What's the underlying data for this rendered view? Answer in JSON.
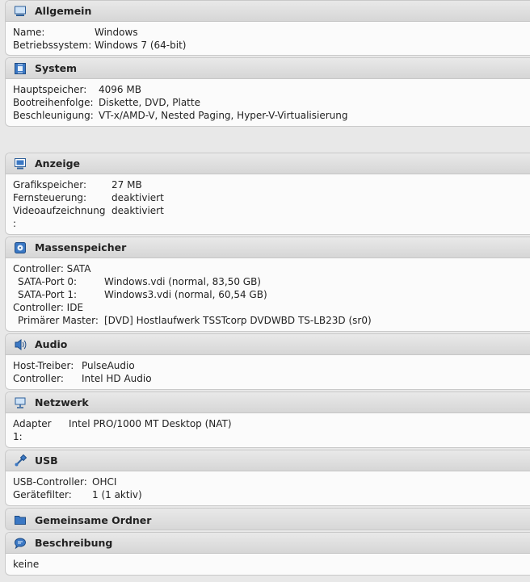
{
  "general": {
    "title": "Allgemein",
    "icon": "monitor-icon",
    "rows": [
      {
        "key": "Name:",
        "value": "Windows"
      },
      {
        "key": "Betriebssystem:",
        "value": "Windows 7 (64-bit)"
      }
    ]
  },
  "system": {
    "title": "System",
    "icon": "chip-icon",
    "rows": [
      {
        "key": "Hauptspeicher:",
        "value": "4096 MB"
      },
      {
        "key": "Bootreihenfolge:",
        "value": "Diskette, DVD, Platte"
      },
      {
        "key": "Beschleunigung:",
        "value": "VT-x/AMD-V, Nested Paging, Hyper-V-Virtualisierung"
      }
    ]
  },
  "display": {
    "title": "Anzeige",
    "icon": "display-icon",
    "rows": [
      {
        "key": "Grafikspeicher:",
        "value": "27 MB"
      },
      {
        "key": "Fernsteuerung:",
        "value": "deaktiviert"
      },
      {
        "key": "Videoaufzeichnung",
        "value": "deaktiviert"
      },
      {
        "key": ":",
        "value": ""
      }
    ]
  },
  "storage": {
    "title": "Massenspeicher",
    "icon": "storage-icon",
    "controller_sata": "Controller: SATA",
    "sata0_key": "SATA-Port 0:",
    "sata0_value": "Windows.vdi (normal, 83,50 GB)",
    "sata1_key": "SATA-Port 1:",
    "sata1_value": "Windows3.vdi (normal, 60,54 GB)",
    "controller_ide": "Controller: IDE",
    "ide_key": "Primärer Master:",
    "ide_value": "[DVD] Hostlaufwerk TSSTcorp DVDWBD TS-LB23D  (sr0)"
  },
  "audio": {
    "title": "Audio",
    "icon": "speaker-icon",
    "rows": [
      {
        "key": "Host-Treiber:",
        "value": "PulseAudio"
      },
      {
        "key": "Controller:",
        "value": "Intel HD Audio"
      }
    ]
  },
  "network": {
    "title": "Netzwerk",
    "icon": "network-icon",
    "rows": [
      {
        "key": "Adapter",
        "value": "Intel PRO/1000 MT Desktop (NAT)"
      },
      {
        "key": "1:",
        "value": ""
      }
    ]
  },
  "usb": {
    "title": "USB",
    "icon": "usb-icon",
    "rows": [
      {
        "key": "USB-Controller:",
        "value": "OHCI"
      },
      {
        "key": "Gerätefilter:",
        "value": "1 (1 aktiv)"
      }
    ]
  },
  "shared": {
    "title": "Gemeinsame Ordner",
    "icon": "folder-icon"
  },
  "description": {
    "title": "Beschreibung",
    "icon": "speech-bubble-icon",
    "text": "keine"
  }
}
